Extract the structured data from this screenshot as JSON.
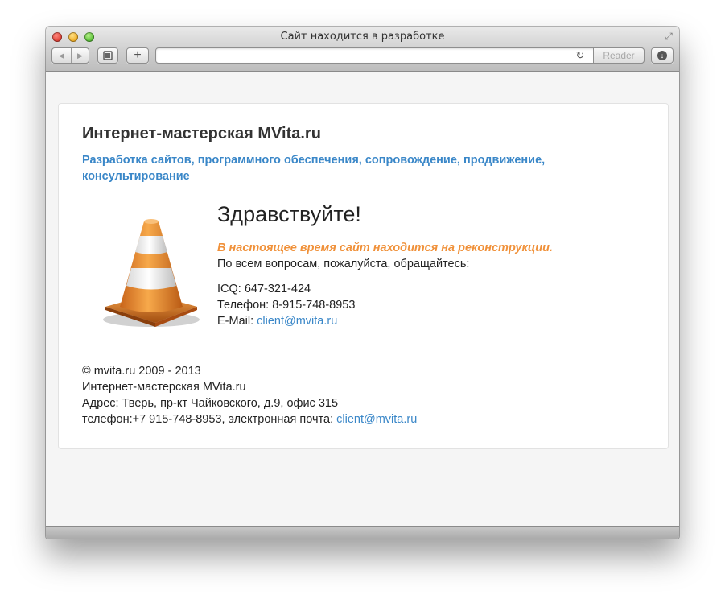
{
  "window": {
    "title": "Сайт находится в разработке"
  },
  "toolbar": {
    "url_value": "",
    "reader_label": "Reader",
    "plus_label": "+",
    "back_icon": "back-arrow-icon",
    "forward_icon": "forward-arrow-icon",
    "reload_icon": "reload-icon",
    "download_icon": "download-icon"
  },
  "site": {
    "title": "Интернет-мастерская MVita.ru",
    "tagline": "Разработка сайтов, программного обеспечения, сопровождение, продвижение, консультирование"
  },
  "content": {
    "greeting": "Здравствуйте!",
    "notice": "В настоящее время сайт находится на реконструкции.",
    "contact_ask": "По всем вопросам, пожалуйста, обращайтесь:",
    "icq": "ICQ: 647-321-424",
    "phone": "Телефон: 8-915-748-8953",
    "email_label": "E-Mail: ",
    "email": "client@mvita.ru"
  },
  "footer": {
    "copyright": "© mvita.ru 2009 - 2013",
    "company": "Интернет-мастерская MVita.ru",
    "address": "Адрес: Тверь, пр-кт Чайковского, д.9, офис 315",
    "contacts_prefix": "телефон:+7 915-748-8953, электронная почта: ",
    "email": "client@mvita.ru"
  },
  "colors": {
    "link": "#3a87c8",
    "notice": "#f0913a",
    "cone_orange": "#e8892a"
  }
}
